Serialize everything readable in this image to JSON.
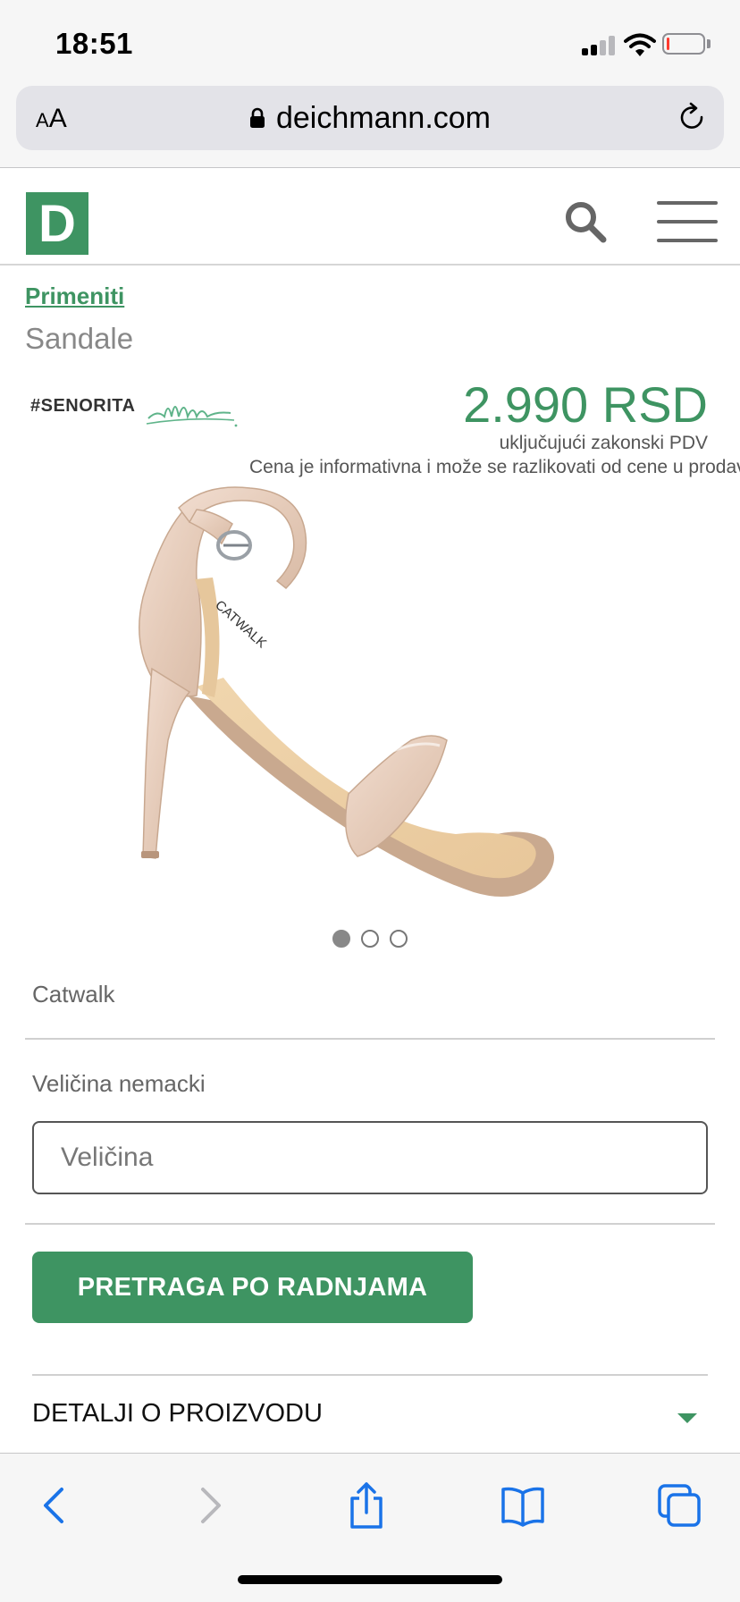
{
  "status_bar": {
    "time": "18:51"
  },
  "browser": {
    "text_size_label_small": "A",
    "text_size_label_large": "A",
    "url": "deichmann.com"
  },
  "site": {
    "logo_letter": "D",
    "brand_color": "#3e9462"
  },
  "product": {
    "breadcrumb": "Primeniti",
    "category": "Sandale",
    "tag": "#SENORITA",
    "price": "2.990 RSD",
    "vat_note": "uključujući zakonski PDV",
    "info_note": "Cena je informativna i može se razlikovati od cene u prodavnici",
    "brand": "Catwalk",
    "shoe_label": "CATWALK",
    "image_count": 3,
    "active_image": 1
  },
  "form": {
    "size_label": "Veličina nemacki",
    "size_placeholder": "Veličina",
    "store_search_button": "PRETRAGA PO RADNJAMA",
    "details_label": "DETALJI O PROIZVODU"
  },
  "icons": {
    "lock": "lock-icon",
    "reload": "reload-icon",
    "search": "search-icon",
    "menu": "menu-icon",
    "back": "chevron-left-icon",
    "forward": "chevron-right-icon",
    "share": "share-icon",
    "bookmarks": "book-icon",
    "tabs": "tabs-icon"
  }
}
